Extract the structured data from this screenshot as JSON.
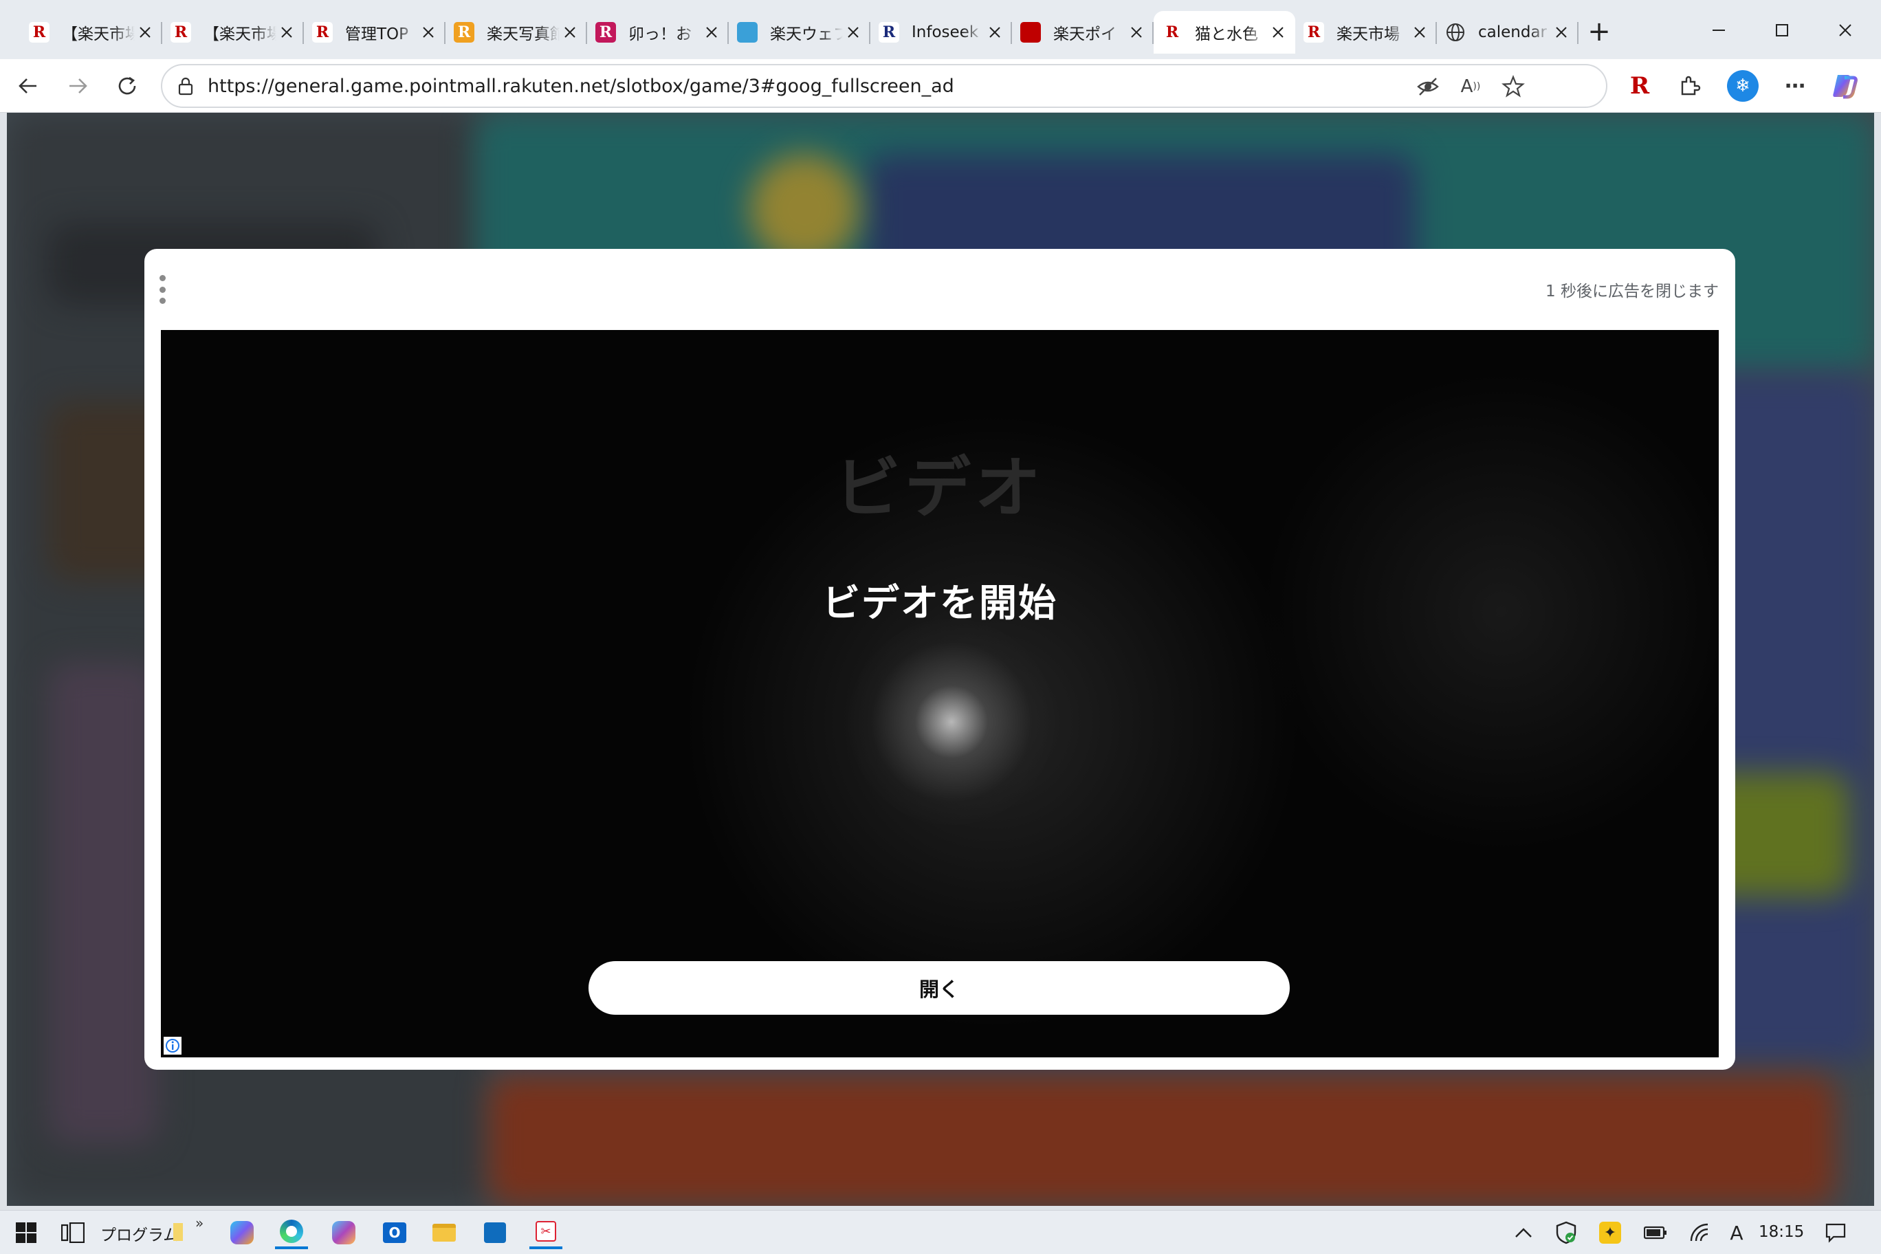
{
  "browser": {
    "tabs": [
      {
        "title": "【楽天市場】",
        "favicon": "rakuten-r",
        "color": "#bf0000",
        "active": false
      },
      {
        "title": "【楽天市場】",
        "favicon": "rakuten-r",
        "color": "#bf0000",
        "active": false
      },
      {
        "title": "管理TOP",
        "favicon": "rakuten-r",
        "color": "#bf0000",
        "active": false
      },
      {
        "title": "楽天写真館",
        "favicon": "rakuten-r",
        "color": "#f0a020",
        "active": false
      },
      {
        "title": "卯っ！お",
        "favicon": "rakuten-r",
        "color": "#c2185b",
        "active": false
      },
      {
        "title": "楽天ウェブ",
        "favicon": "rakuten-web",
        "color": "#3aa0d8",
        "active": false
      },
      {
        "title": "Infoseek",
        "favicon": "infoseek-r",
        "color": "#1a2a7a",
        "active": false
      },
      {
        "title": "楽天ポイ",
        "favicon": "rakuten-point",
        "color": "#bf0000",
        "active": false
      },
      {
        "title": "猫と水色",
        "favicon": "rakuten-r",
        "color": "#bf0000",
        "active": true
      },
      {
        "title": "楽天市場",
        "favicon": "rakuten-r",
        "color": "#bf0000",
        "active": false
      },
      {
        "title": "calendar",
        "favicon": "globe",
        "color": "#444444",
        "active": false
      }
    ],
    "url": "https://general.game.pointmall.rakuten.net/slotbox/game/3#goog_fullscreen_ad",
    "new_tab_label": "+"
  },
  "ad": {
    "countdown": "1 秒後に広告を閉じます",
    "brand_text": "ビデオ",
    "headline": "ビデオを開始",
    "open_button": "開く"
  },
  "taskbar": {
    "programs_label": "プログラム",
    "chevron": "»",
    "clock": "18:15",
    "ime": "A"
  },
  "colors": {
    "accent": "#0078d4",
    "rakuten_red": "#bf0000"
  }
}
